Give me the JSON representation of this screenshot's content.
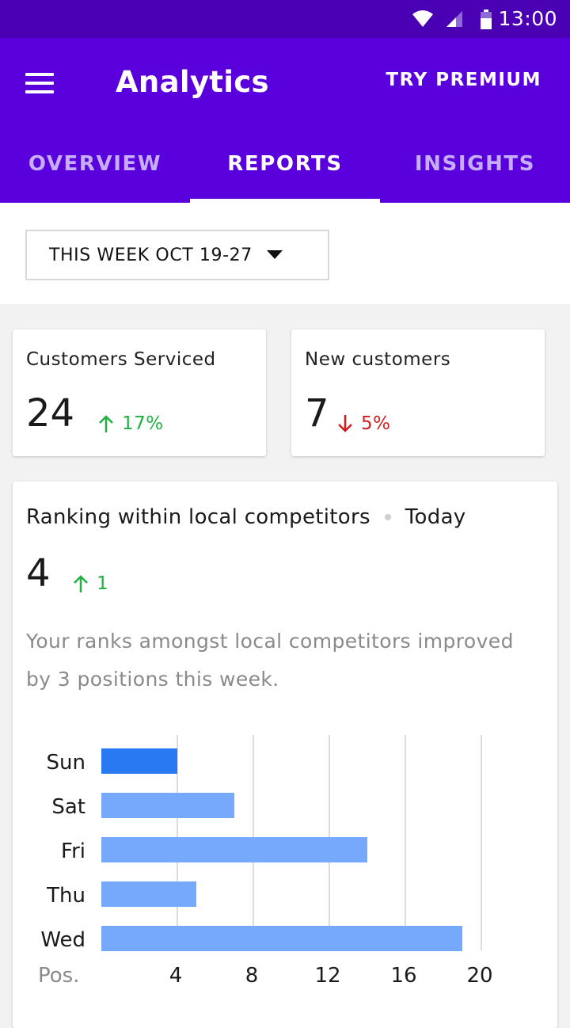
{
  "status_bar": {
    "time": "13:00"
  },
  "app_bar": {
    "title": "Analytics",
    "premium_label": "TRY PREMIUM"
  },
  "tabs": [
    {
      "label": "OVERVIEW",
      "active": false
    },
    {
      "label": "REPORTS",
      "active": true
    },
    {
      "label": "INSIGHTS",
      "active": false
    }
  ],
  "filter": {
    "selected": "THIS WEEK OCT 19-27"
  },
  "stats": {
    "customers_serviced": {
      "label": "Customers Serviced",
      "value": "24",
      "change": "17%",
      "direction": "up"
    },
    "new_customers": {
      "label": "New customers",
      "value": "7",
      "change": "5%",
      "direction": "down"
    }
  },
  "ranking": {
    "title": "Ranking within local competitors",
    "period": "Today",
    "value": "4",
    "change": "1",
    "direction": "up",
    "description": "Your ranks amongst local competitors improved by 3 positions this week."
  },
  "colors": {
    "primary": "#5a00dc",
    "status_bar": "#4a00b3",
    "up": "#1fb141",
    "down": "#d01d1d",
    "bar_highlight": "#2979f2",
    "bar": "#76a9fc"
  },
  "chart_data": {
    "type": "bar",
    "orientation": "horizontal",
    "categories": [
      "Sun",
      "Sat",
      "Fri",
      "Thu",
      "Wed"
    ],
    "values": [
      4,
      7,
      14,
      5,
      19
    ],
    "highlight_index": 0,
    "xlabel": "Pos.",
    "xticks": [
      4,
      8,
      12,
      16,
      20
    ],
    "xlim": [
      0,
      20
    ],
    "grid": true
  }
}
